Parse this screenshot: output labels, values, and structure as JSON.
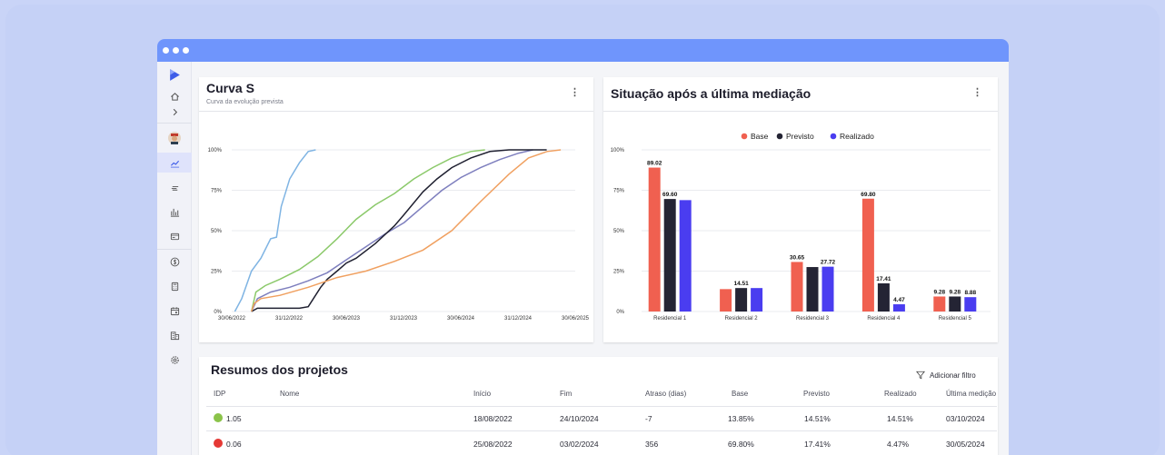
{
  "sidebar": {
    "items": [
      {
        "icon": "logo-icon"
      },
      {
        "icon": "home-icon"
      },
      {
        "icon": "chevron-right-icon"
      },
      {
        "icon": "avatar"
      },
      {
        "icon": "line-chart-icon"
      },
      {
        "icon": "text-lines-icon"
      },
      {
        "icon": "bar-chart-icon"
      },
      {
        "icon": "card-icon"
      },
      {
        "icon": "dollar-icon"
      },
      {
        "icon": "calculator-icon"
      },
      {
        "icon": "calendar-icon"
      },
      {
        "icon": "building-icon"
      },
      {
        "icon": "settings-icon"
      }
    ]
  },
  "curva": {
    "title": "Curva S",
    "subtitle": "Curva da evolução prevista",
    "menu_icon": "⋮"
  },
  "situacao": {
    "title": "Situação após a última mediação",
    "menu_icon": "⋮"
  },
  "resumos": {
    "title": "Resumos dos projetos",
    "filter_label": "Adicionar filtro",
    "columns": [
      "IDP",
      "Nome",
      "Início",
      "Fim",
      "Atraso (dias)",
      "Base",
      "Previsto",
      "Realizado",
      "Última medição"
    ],
    "rows": [
      {
        "status_color": "#8bc34a",
        "idp": "1.05",
        "nome": "",
        "inicio": "18/08/2022",
        "fim": "24/10/2024",
        "atraso": "-7",
        "base": "13.85%",
        "previsto": "14.51%",
        "realizado": "14.51%",
        "ultima": "03/10/2024"
      },
      {
        "status_color": "#e53935",
        "idp": "0.06",
        "nome": "",
        "inicio": "25/08/2022",
        "fim": "03/02/2024",
        "atraso": "356",
        "base": "69.80%",
        "previsto": "17.41%",
        "realizado": "4.47%",
        "ultima": "30/05/2024"
      }
    ]
  },
  "chart_data": [
    {
      "type": "line",
      "title": "Curva S",
      "subtitle": "Curva da evolução prevista",
      "x_tick_labels": [
        "30/06/2022",
        "31/12/2022",
        "30/06/2023",
        "31/12/2023",
        "30/06/2024",
        "31/12/2024",
        "30/06/2025"
      ],
      "y_tick_labels": [
        "0%",
        "25%",
        "50%",
        "75%",
        "100%"
      ],
      "ylim": [
        0,
        100
      ],
      "x_domain": [
        "2022-06-30",
        "2025-06-30"
      ],
      "grid": true,
      "series": [
        {
          "color": "#7fb4e3",
          "x": [
            "2022-07-10",
            "2022-08-01",
            "2022-09-01",
            "2022-10-01",
            "2022-11-01",
            "2022-11-20",
            "2022-12-05",
            "2023-01-01",
            "2023-02-01",
            "2023-03-01",
            "2023-03-25"
          ],
          "y": [
            0,
            8,
            25,
            33,
            45,
            46,
            65,
            82,
            92,
            99,
            100
          ]
        },
        {
          "color": "#8bc96a",
          "x": [
            "2022-09-01",
            "2022-09-15",
            "2022-10-15",
            "2022-12-01",
            "2023-02-01",
            "2023-04-01",
            "2023-06-01",
            "2023-08-01",
            "2023-10-01",
            "2023-12-01",
            "2024-02-01",
            "2024-04-01",
            "2024-06-01",
            "2024-08-01",
            "2024-09-15"
          ],
          "y": [
            0,
            12,
            16,
            20,
            26,
            34,
            45,
            57,
            66,
            73,
            82,
            89,
            95,
            99,
            100
          ]
        },
        {
          "color": "#7e7fbe",
          "x": [
            "2022-09-01",
            "2022-09-20",
            "2022-11-01",
            "2023-01-01",
            "2023-03-01",
            "2023-05-01",
            "2023-07-01",
            "2023-09-01",
            "2023-11-01",
            "2024-01-01",
            "2024-03-01",
            "2024-05-01",
            "2024-07-01",
            "2024-09-01",
            "2024-11-01",
            "2025-01-01",
            "2025-02-15"
          ],
          "y": [
            0,
            8,
            12,
            15,
            19,
            24,
            32,
            40,
            48,
            55,
            65,
            75,
            83,
            89,
            94,
            98,
            100
          ]
        },
        {
          "color": "#1f2030",
          "x": [
            "2022-09-01",
            "2022-09-20",
            "2023-02-01",
            "2023-03-01",
            "2023-04-10",
            "2023-05-01",
            "2023-06-01",
            "2023-07-01",
            "2023-08-01",
            "2023-10-01",
            "2023-12-01",
            "2024-01-01",
            "2024-03-01",
            "2024-04-15",
            "2024-06-01",
            "2024-08-01",
            "2024-10-01",
            "2024-12-01",
            "2025-02-01",
            "2025-03-31"
          ],
          "y": [
            0,
            2,
            2,
            3,
            15,
            20,
            25,
            30,
            33,
            42,
            53,
            60,
            74,
            82,
            89,
            95,
            99,
            100,
            100,
            100
          ]
        },
        {
          "color": "#f0a060",
          "x": [
            "2022-09-01",
            "2022-09-10",
            "2022-10-01",
            "2022-12-01",
            "2023-03-01",
            "2023-06-01",
            "2023-09-01",
            "2023-12-01",
            "2024-03-01",
            "2024-06-01",
            "2024-09-01",
            "2024-12-01",
            "2025-02-01",
            "2025-04-01",
            "2025-05-15"
          ],
          "y": [
            0,
            5,
            8,
            10,
            15,
            21,
            25,
            31,
            38,
            50,
            68,
            85,
            95,
            99,
            100
          ]
        }
      ]
    },
    {
      "type": "bar",
      "title": "Situação após a última mediação",
      "categories": [
        "Residencial 1",
        "Residencial 2",
        "Residencial 3",
        "Residencial 4",
        "Residencial 5"
      ],
      "y_tick_labels": [
        "0%",
        "25%",
        "50%",
        "75%",
        "100%"
      ],
      "ylim": [
        0,
        100
      ],
      "grid": true,
      "legend_position": "top",
      "series": [
        {
          "name": "Base",
          "color": "#f06050",
          "values": [
            89.02,
            13.85,
            30.65,
            69.8,
            9.28
          ],
          "labels": [
            "89.02",
            "",
            "30.65",
            "69.80",
            "9.28"
          ]
        },
        {
          "name": "Previsto",
          "color": "#242434",
          "values": [
            69.6,
            14.51,
            27.5,
            17.41,
            9.28
          ],
          "labels": [
            "69.60",
            "14.51",
            "",
            "17.41",
            "9.28"
          ]
        },
        {
          "name": "Realizado",
          "color": "#4a3df0",
          "values": [
            68.9,
            14.51,
            27.72,
            4.47,
            8.88
          ],
          "labels": [
            "",
            "",
            "27.72",
            "4.47",
            "8.88"
          ]
        }
      ]
    }
  ]
}
